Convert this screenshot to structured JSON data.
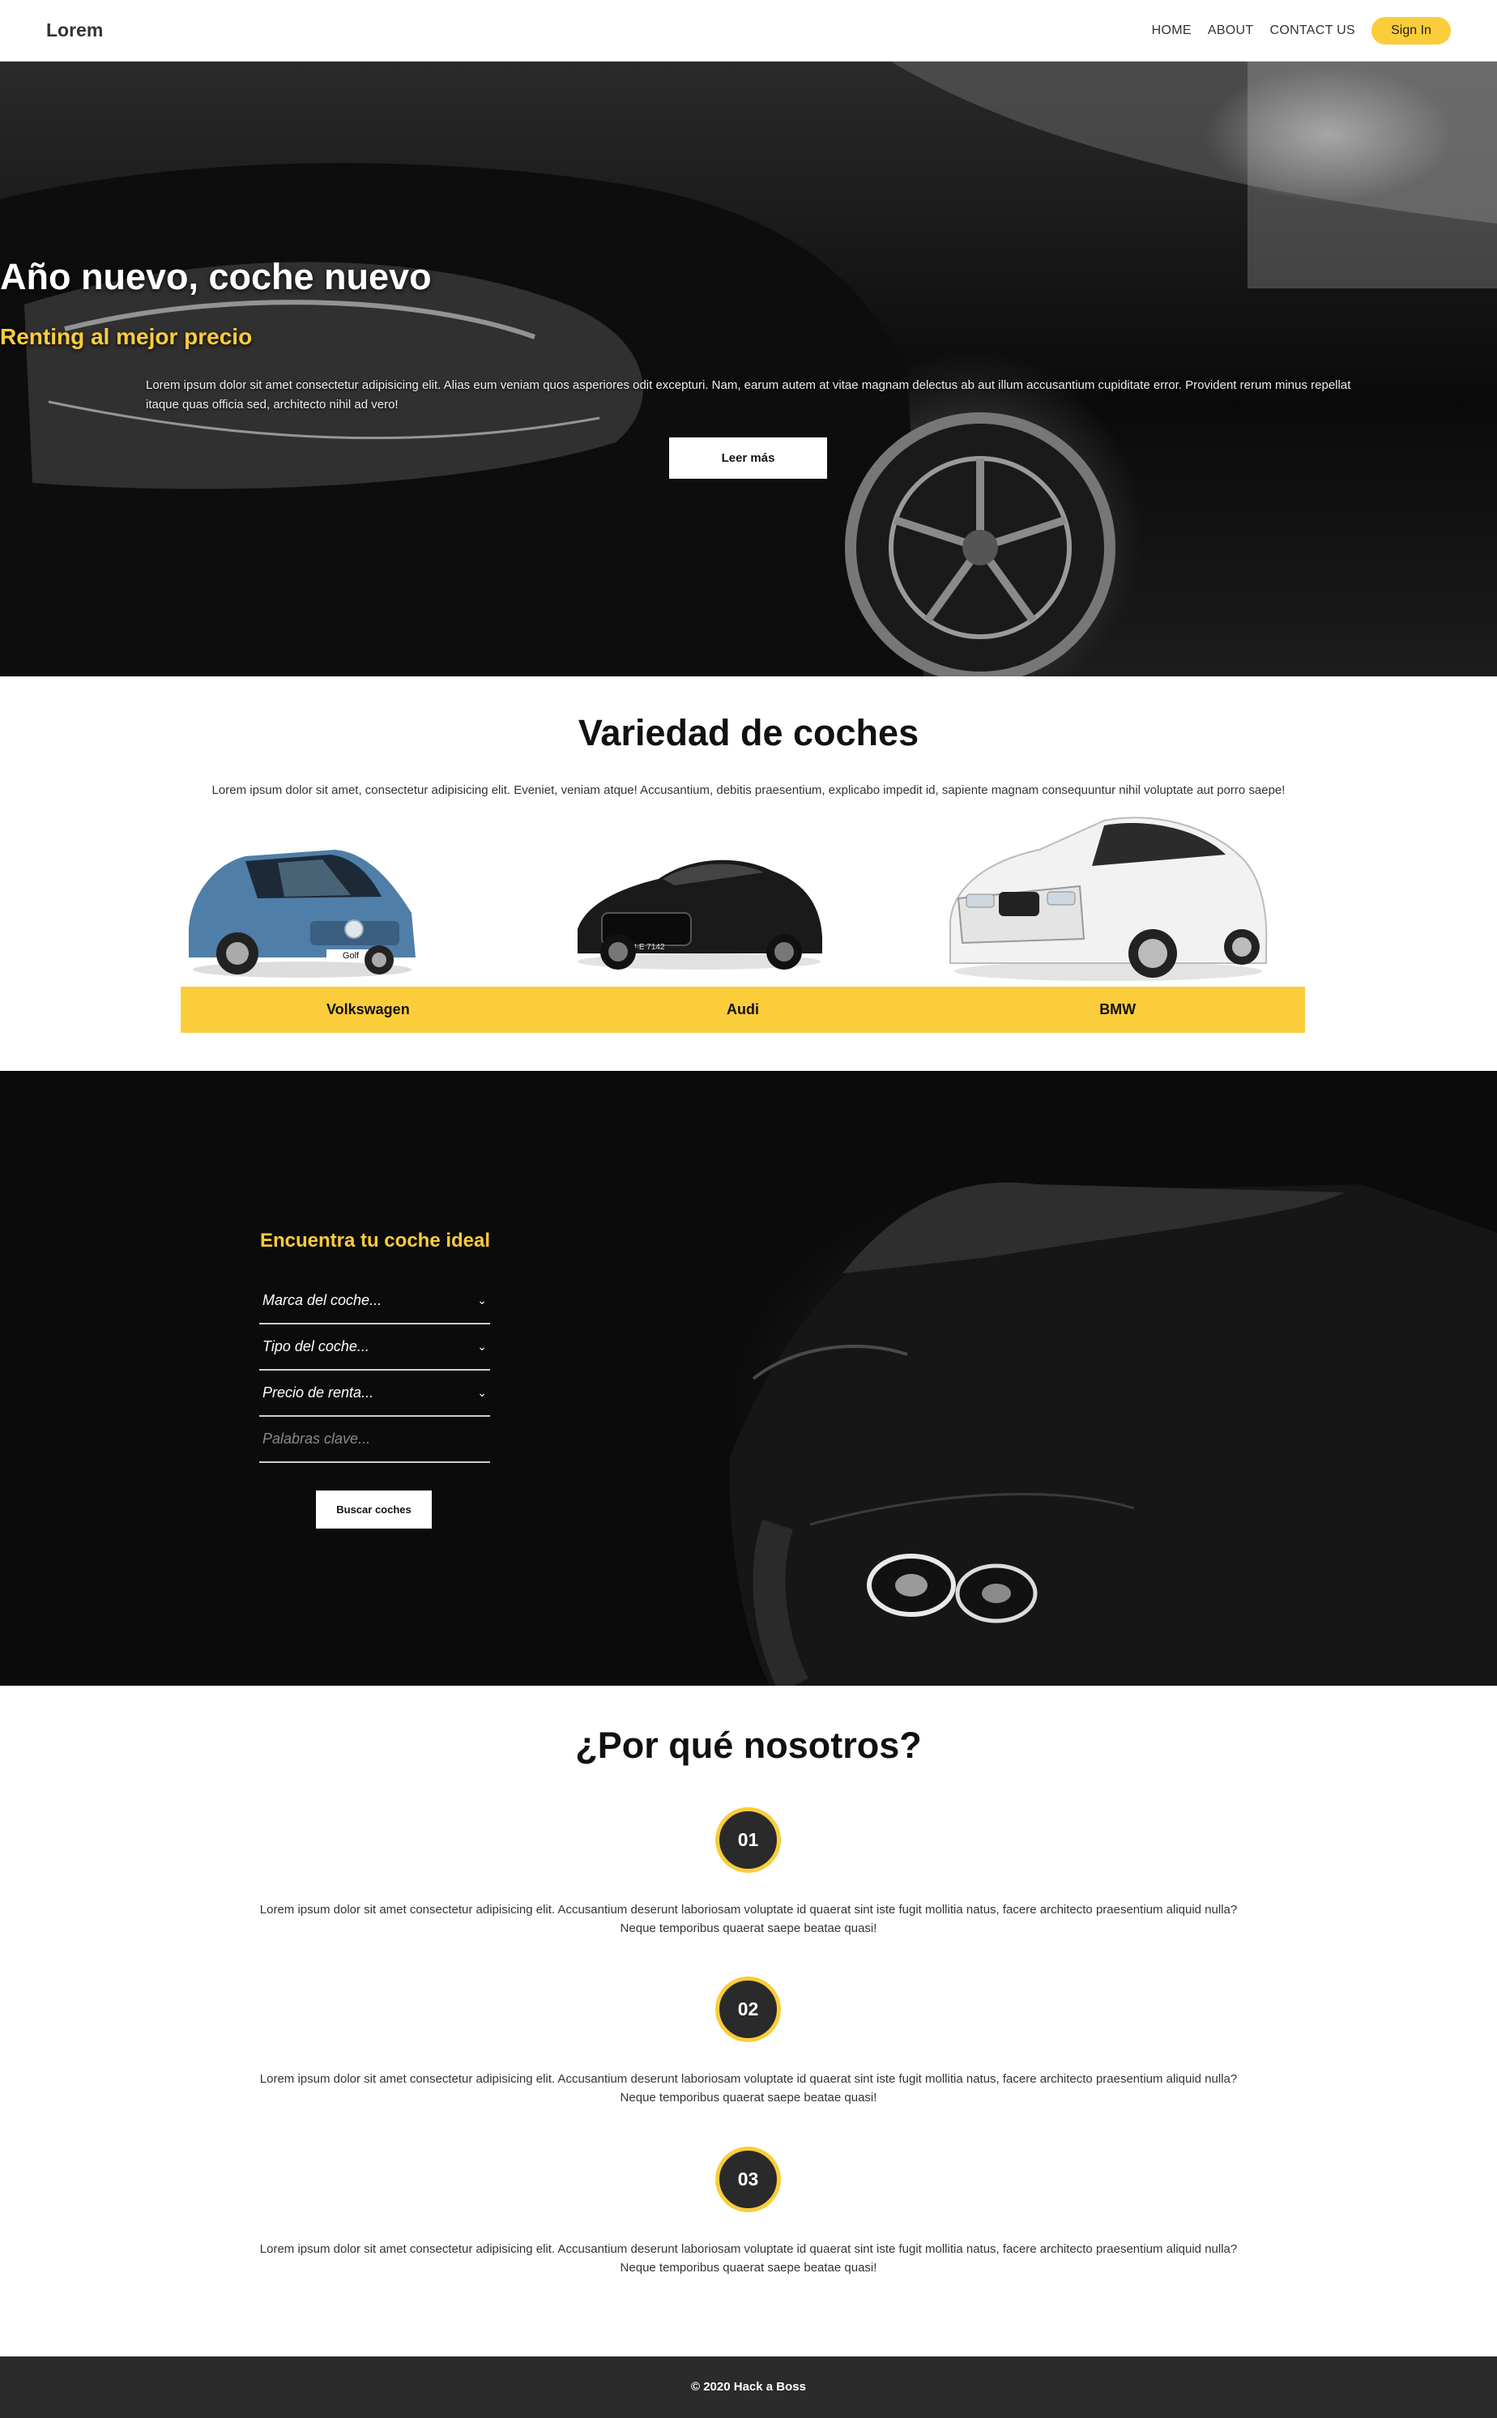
{
  "nav": {
    "brand": "Lorem",
    "links": [
      "HOME",
      "ABOUT",
      "CONTACT US"
    ],
    "signin": "Sign In"
  },
  "hero": {
    "title": "Año nuevo, coche nuevo",
    "subtitle": "Renting al mejor precio",
    "text": "Lorem ipsum dolor sit amet consectetur adipisicing elit. Alias eum veniam quos asperiores odit excepturi. Nam, earum autem at vitae magnam delectus ab aut illum accusantium cupiditate error. Provident rerum minus repellat itaque quas officia sed, architecto nihil ad vero!",
    "button": "Leer más"
  },
  "variety": {
    "title": "Variedad de coches",
    "text": "Lorem ipsum dolor sit amet, consectetur adipisicing elit. Eveniet, veniam atque! Accusantium, debitis praesentium, explicabo impedit id, sapiente magnam consequuntur nihil voluptate aut porro saepe!",
    "brands": [
      "Volkswagen",
      "Audi",
      "BMW"
    ],
    "plates": [
      "Golf",
      "IN·E 7142"
    ]
  },
  "finder": {
    "title": "Encuentra tu coche ideal",
    "fields": [
      "Marca del coche...",
      "Tipo del coche...",
      "Precio de renta..."
    ],
    "keywords_placeholder": "Palabras clave...",
    "button": "Buscar coches"
  },
  "why": {
    "title": "¿Por qué nosotros?",
    "items": [
      {
        "number": "01",
        "line1": "Lorem ipsum dolor sit amet consectetur adipisicing elit. Accusantium deserunt laboriosam voluptate id quaerat sint iste fugit mollitia natus, facere architecto praesentium aliquid nulla?",
        "line2": "Neque temporibus quaerat saepe beatae quasi!"
      },
      {
        "number": "02",
        "line1": "Lorem ipsum dolor sit amet consectetur adipisicing elit. Accusantium deserunt laboriosam voluptate id quaerat sint iste fugit mollitia natus, facere architecto praesentium aliquid nulla?",
        "line2": "Neque temporibus quaerat saepe beatae quasi!"
      },
      {
        "number": "03",
        "line1": "Lorem ipsum dolor sit amet consectetur adipisicing elit. Accusantium deserunt laboriosam voluptate id quaerat sint iste fugit mollitia natus, facere architecto praesentium aliquid nulla?",
        "line2": "Neque temporibus quaerat saepe beatae quasi!"
      }
    ]
  },
  "footer": {
    "text": "© 2020 Hack a Boss"
  },
  "colors": {
    "accent": "#fbcd3b",
    "dark": "#2b2b2b"
  },
  "icons": {
    "select": "chevron-down-icon"
  }
}
